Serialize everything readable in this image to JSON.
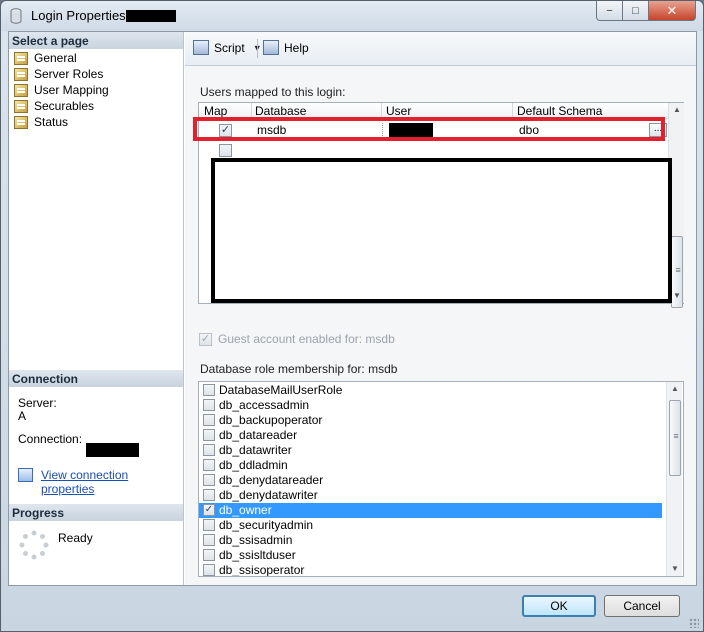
{
  "window": {
    "title": "Login Properties -"
  },
  "sidebar": {
    "select_page_header": "Select a page",
    "items": [
      {
        "label": "General"
      },
      {
        "label": "Server Roles"
      },
      {
        "label": "User Mapping"
      },
      {
        "label": "Securables"
      },
      {
        "label": "Status"
      }
    ],
    "connection_header": "Connection",
    "server_label": "Server:",
    "server_value": "A",
    "connection_label": "Connection:",
    "view_connection_link": "View connection properties",
    "progress_header": "Progress",
    "progress_status": "Ready"
  },
  "toolbar": {
    "script_label": "Script",
    "help_label": "Help"
  },
  "users_mapped": {
    "label": "Users mapped to this login:",
    "columns": [
      "Map",
      "Database",
      "User",
      "Default Schema"
    ],
    "rows": [
      {
        "map": true,
        "database": "msdb",
        "user": "",
        "default_schema": "dbo"
      },
      {
        "map": false,
        "database": "",
        "user": "",
        "default_schema": ""
      }
    ]
  },
  "guest": {
    "label": "Guest account enabled for: msdb",
    "checked": true,
    "enabled": false
  },
  "role_membership": {
    "label": "Database role membership for: msdb",
    "roles": [
      {
        "name": "DatabaseMailUserRole",
        "checked": false
      },
      {
        "name": "db_accessadmin",
        "checked": false
      },
      {
        "name": "db_backupoperator",
        "checked": false
      },
      {
        "name": "db_datareader",
        "checked": false
      },
      {
        "name": "db_datawriter",
        "checked": false
      },
      {
        "name": "db_ddladmin",
        "checked": false
      },
      {
        "name": "db_denydatareader",
        "checked": false
      },
      {
        "name": "db_denydatawriter",
        "checked": false
      },
      {
        "name": "db_owner",
        "checked": true,
        "selected": true
      },
      {
        "name": "db_securityadmin",
        "checked": false
      },
      {
        "name": "db_ssisadmin",
        "checked": false
      },
      {
        "name": "db_ssisltduser",
        "checked": false
      },
      {
        "name": "db_ssisoperator",
        "checked": false
      }
    ]
  },
  "footer": {
    "ok_label": "OK",
    "cancel_label": "Cancel"
  },
  "icons": {
    "check": "✓",
    "ellipsis": "...",
    "minimize": "−",
    "maximize": "□",
    "close": "✕"
  },
  "colors": {
    "selection": "#3399ff",
    "highlight_box": "#e3202e",
    "link": "#1a4fb3"
  }
}
